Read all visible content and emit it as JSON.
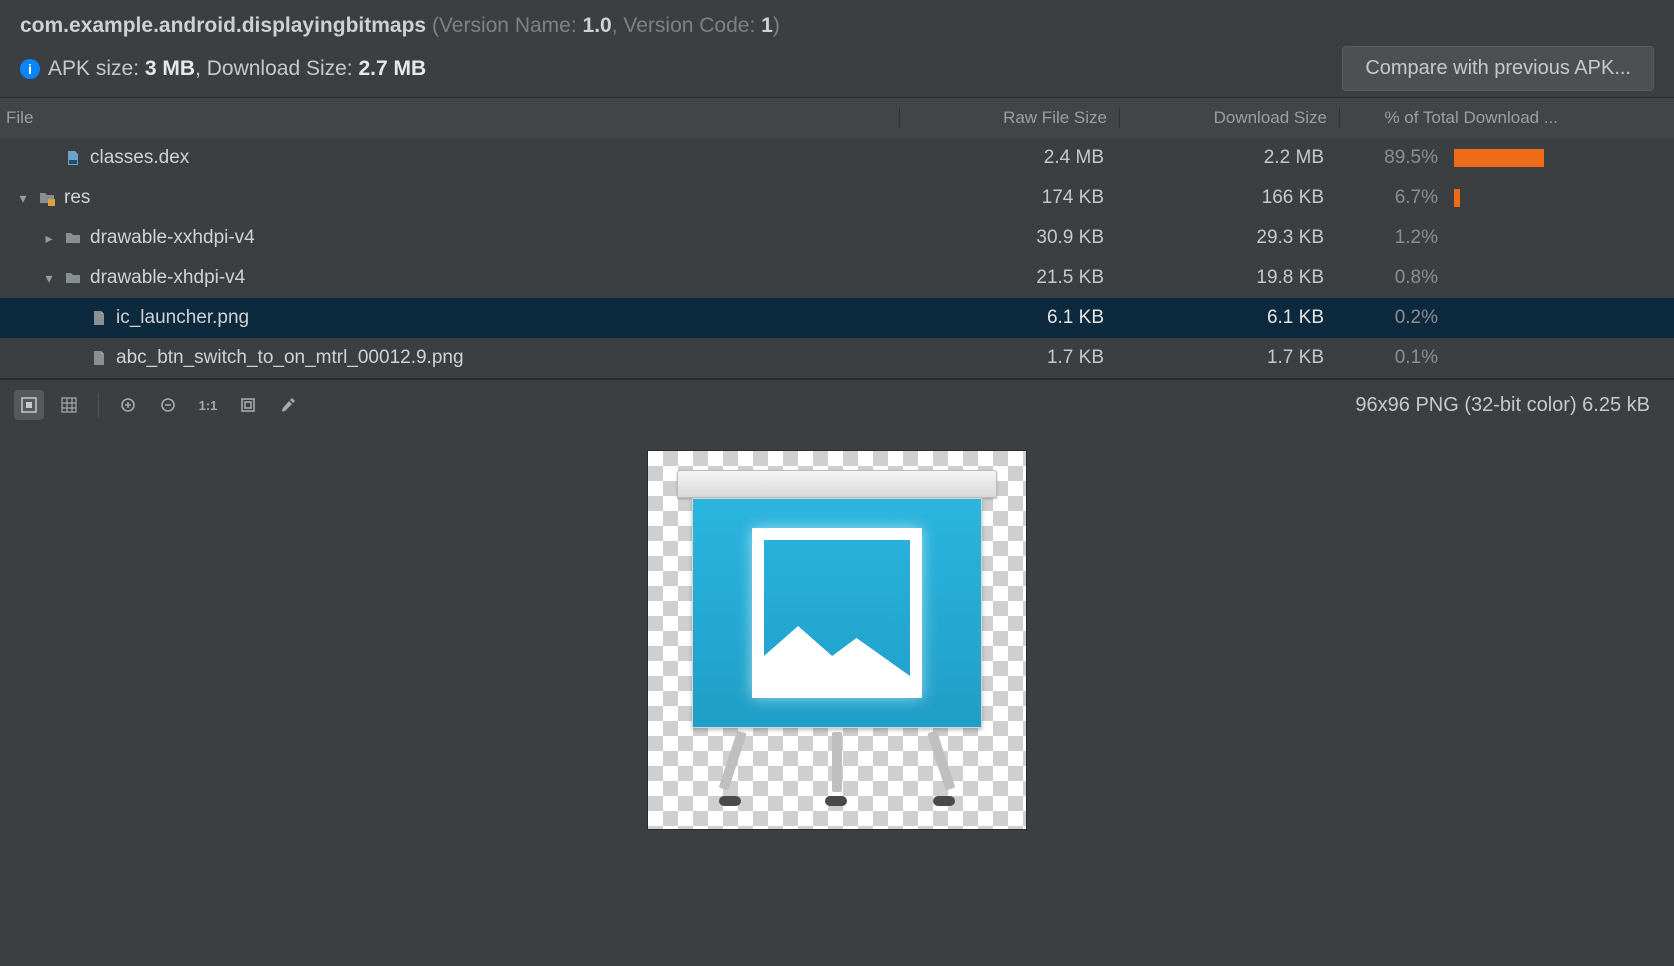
{
  "header": {
    "package_name": "com.example.android.displayingbitmaps",
    "version_name_label": "(Version Name: ",
    "version_name": "1.0",
    "version_code_label": ", Version Code: ",
    "version_code": "1",
    "close_paren": ")",
    "apk_size_label": "APK size: ",
    "apk_size": "3 MB",
    "download_size_label": ", Download Size: ",
    "download_size": "2.7 MB",
    "compare_button": "Compare with previous APK..."
  },
  "columns": {
    "file": "File",
    "raw": "Raw File Size",
    "dl": "Download Size",
    "pct": "% of Total Download ..."
  },
  "rows": [
    {
      "indent": 1,
      "arrow": "none",
      "icon": "dex",
      "name": "classes.dex",
      "raw": "2.4 MB",
      "dl": "2.2 MB",
      "pct": "89.5%",
      "bar": 90,
      "selected": false
    },
    {
      "indent": 0,
      "arrow": "down",
      "icon": "folder-res",
      "name": "res",
      "raw": "174 KB",
      "dl": "166 KB",
      "pct": "6.7%",
      "bar": 6,
      "selected": false
    },
    {
      "indent": 1,
      "arrow": "right",
      "icon": "folder",
      "name": "drawable-xxhdpi-v4",
      "raw": "30.9 KB",
      "dl": "29.3 KB",
      "pct": "1.2%",
      "bar": 0,
      "selected": false
    },
    {
      "indent": 1,
      "arrow": "down",
      "icon": "folder",
      "name": "drawable-xhdpi-v4",
      "raw": "21.5 KB",
      "dl": "19.8 KB",
      "pct": "0.8%",
      "bar": 0,
      "selected": false
    },
    {
      "indent": 2,
      "arrow": "none",
      "icon": "png",
      "name": "ic_launcher.png",
      "raw": "6.1 KB",
      "dl": "6.1 KB",
      "pct": "0.2%",
      "bar": 0,
      "selected": true
    },
    {
      "indent": 2,
      "arrow": "none",
      "icon": "png",
      "name": "abc_btn_switch_to_on_mtrl_00012.9.png",
      "raw": "1.7 KB",
      "dl": "1.7 KB",
      "pct": "0.1%",
      "bar": 0,
      "selected": false
    }
  ],
  "preview": {
    "info": "96x96 PNG (32-bit color) 6.25 kB",
    "icons": {
      "fit": "fit-zoom-icon",
      "grid": "grid-icon",
      "zoom_in": "zoom-in-icon",
      "zoom_out": "zoom-out-icon",
      "one_to_one": "one-to-one-icon",
      "crop": "crop-icon",
      "picker": "color-picker-icon"
    }
  }
}
